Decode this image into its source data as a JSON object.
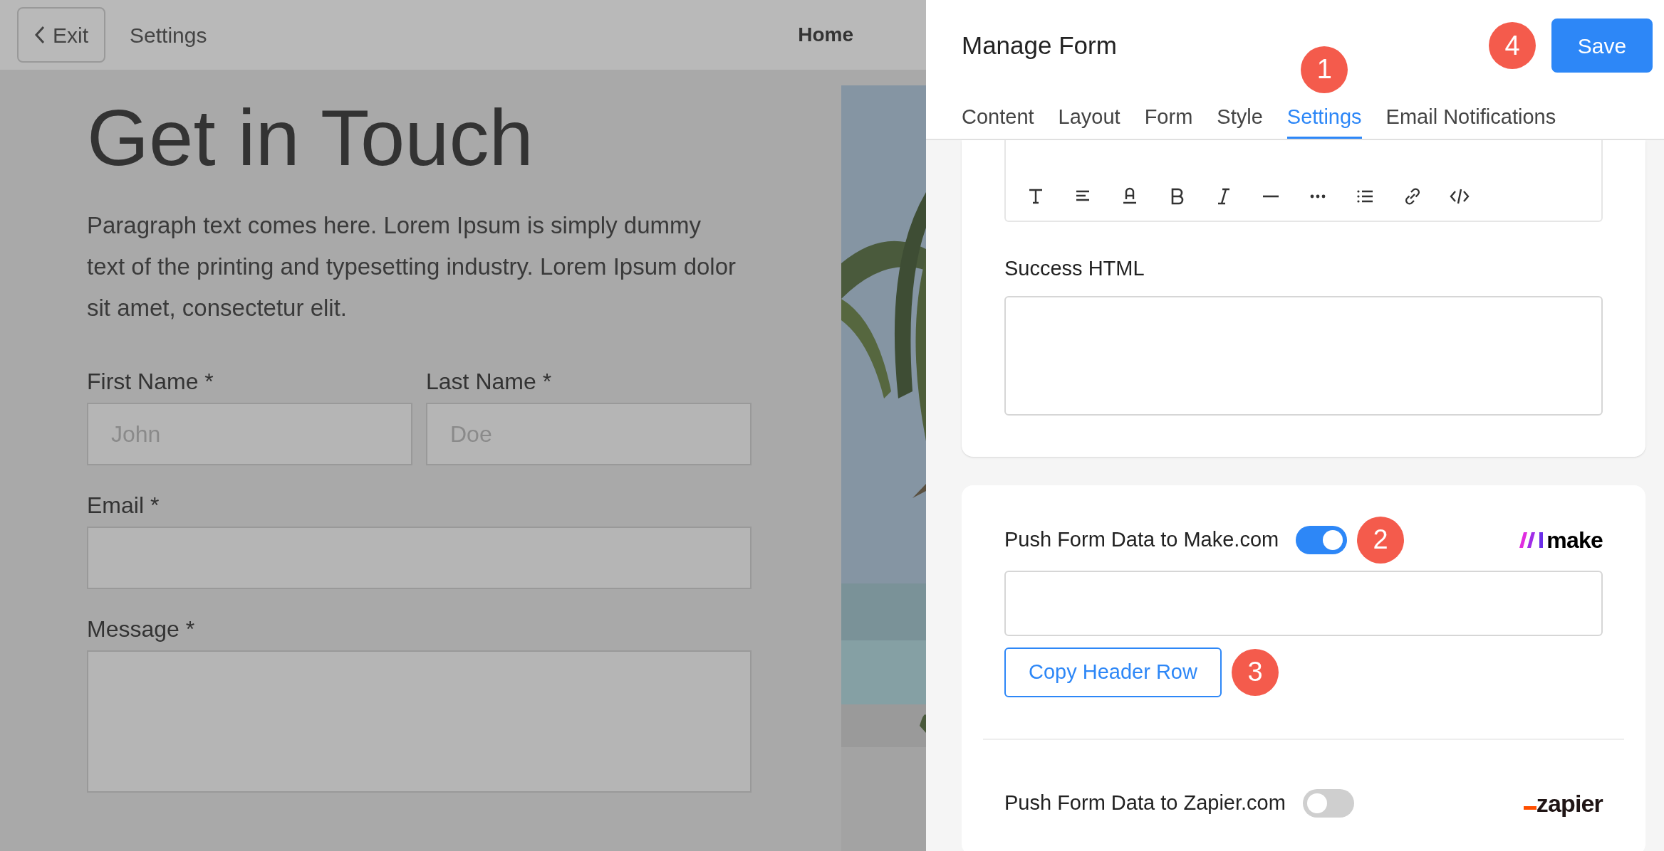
{
  "preview": {
    "top_bar": {
      "exit_button": "Exit",
      "page_title": "Settings",
      "nav_link": "Home"
    },
    "heading": "Get in Touch",
    "paragraph": "Paragraph text comes here. Lorem Ipsum is simply dummy text of the printing and typesetting industry. Lorem Ipsum dolor sit amet, consectetur elit.",
    "fields": [
      {
        "kind": "input",
        "label": "First Name *",
        "placeholder": "John"
      },
      {
        "kind": "input",
        "label": "Last Name *",
        "placeholder": "Doe"
      },
      {
        "kind": "input",
        "label": "Email *"
      },
      {
        "kind": "textarea",
        "label": "Message *"
      }
    ]
  },
  "panel": {
    "title": "Manage Form",
    "save_button": "Save",
    "save_callout": "4",
    "tabs": [
      {
        "label": "Content",
        "selected": false
      },
      {
        "label": "Layout",
        "selected": false
      },
      {
        "label": "Form",
        "selected": false
      },
      {
        "label": "Style",
        "selected": false
      },
      {
        "label": "Settings",
        "selected": true,
        "callout": "1"
      },
      {
        "label": "Email Notifications",
        "selected": false
      }
    ],
    "success_html": {
      "label": "Success HTML"
    },
    "integrations": [
      {
        "kind": "make",
        "label": "Push Form Data to Make.com",
        "on": true,
        "callout": "2",
        "logo": "make",
        "button": "Copy Header Row",
        "button_callout": "3"
      },
      {
        "kind": "zapier",
        "label": "Push Form Data to Zapier.com",
        "on": false,
        "logo": "zapier"
      }
    ]
  }
}
